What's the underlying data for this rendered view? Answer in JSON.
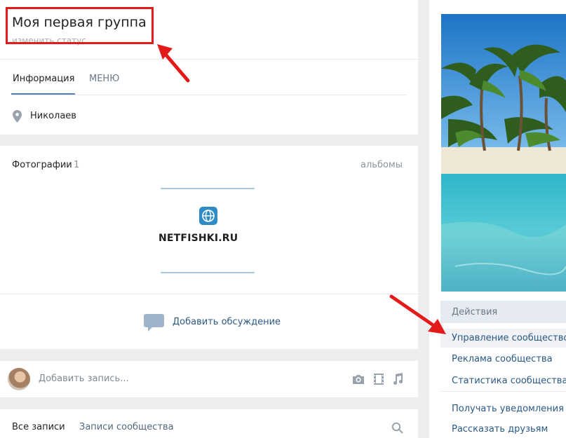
{
  "header": {
    "title": "Моя первая группа",
    "status": "изменить статус",
    "tabs": [
      "Информация",
      "МЕНЮ"
    ],
    "city": "Николаев"
  },
  "photos": {
    "title": "Фотографии",
    "count": "1",
    "albums": "альбомы",
    "logo_text": "NETFISHKI.RU"
  },
  "discussion": {
    "add_label": "Добавить обсуждение"
  },
  "composer": {
    "placeholder": "Добавить запись..."
  },
  "wall": {
    "tabs": [
      "Все записи",
      "Записи сообщества"
    ]
  },
  "actions": {
    "title": "Действия",
    "items": [
      "Управление сообществом",
      "Реклама сообщества",
      "Статистика сообщества",
      "Получать уведомления",
      "Рассказать друзьям"
    ]
  },
  "colors": {
    "highlight_red": "#e31a1a",
    "link_blue": "#2a5885",
    "accent_blue": "#5181b8"
  }
}
